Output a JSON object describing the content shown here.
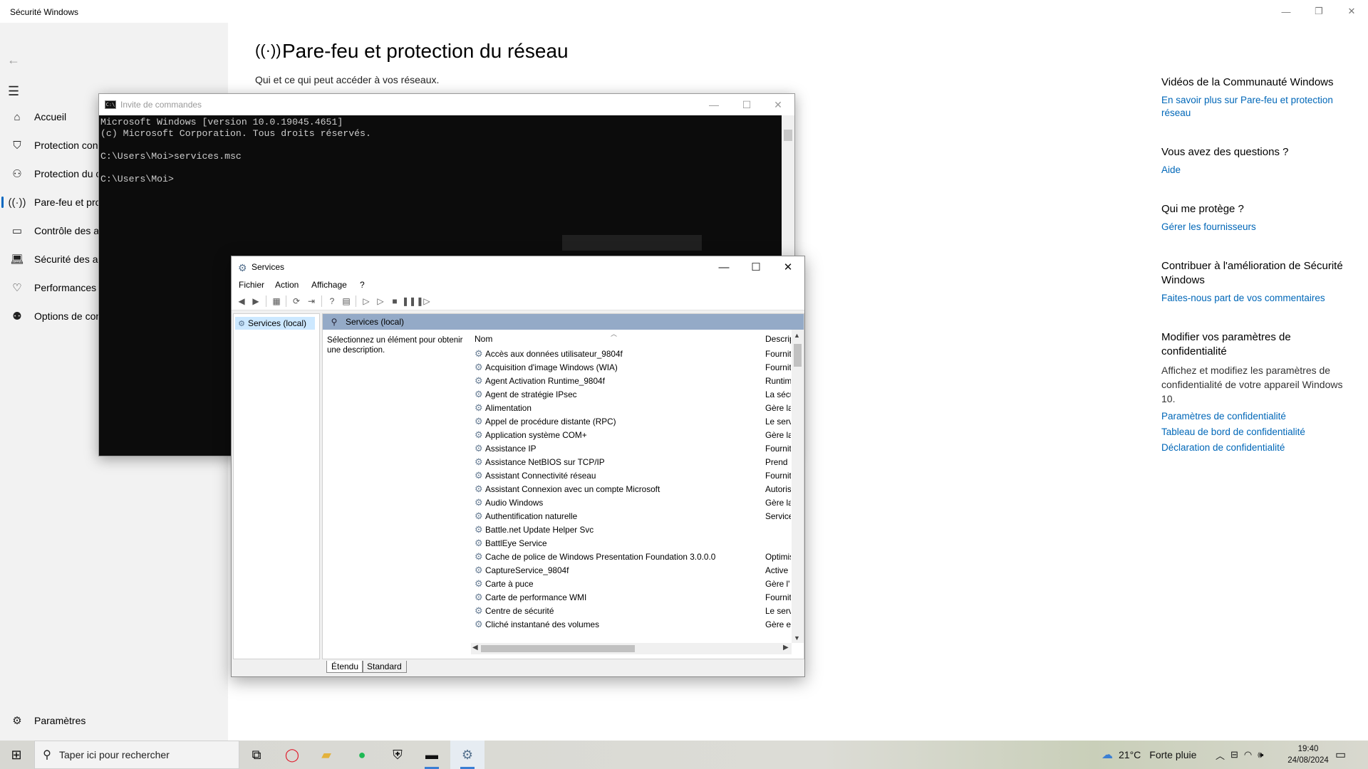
{
  "security": {
    "window_title": "Sécurité Windows",
    "heading": "Pare-feu et protection du réseau",
    "subheading": "Qui et ce qui peut accéder à vos réseaux.",
    "nav": [
      {
        "label": "Accueil"
      },
      {
        "label": "Protection con"
      },
      {
        "label": "Protection du c"
      },
      {
        "label": "Pare-feu et pro"
      },
      {
        "label": "Contrôle des a"
      },
      {
        "label": "Sécurité des ap"
      },
      {
        "label": "Performances e"
      },
      {
        "label": "Options de con"
      }
    ],
    "settings_label": "Paramètres",
    "right_panel": {
      "videos_title": "Vidéos de la Communauté Windows",
      "videos_link": "En savoir plus sur Pare-feu et protection réseau",
      "questions_title": "Vous avez des questions ?",
      "questions_link": "Aide",
      "protect_title": "Qui me protège ?",
      "protect_link": "Gérer les fournisseurs",
      "contribute_title": "Contribuer à l'amélioration de Sécurité Windows",
      "contribute_link": "Faites-nous part de vos commentaires",
      "privacy_title": "Modifier vos paramètres de confidentialité",
      "privacy_text": "Affichez et modifiez les paramètres de confidentialité de votre appareil Windows 10.",
      "privacy_link1": "Paramètres de confidentialité",
      "privacy_link2": "Tableau de bord de confidentialité",
      "privacy_link3": "Déclaration de confidentialité"
    }
  },
  "cmd": {
    "title": "Invite de commandes",
    "lines": "Microsoft Windows [version 10.0.19045.4651]\n(c) Microsoft Corporation. Tous droits réservés.\n\nC:\\Users\\Moi>services.msc\n\nC:\\Users\\Moi>"
  },
  "services": {
    "title": "Services",
    "menu": [
      "Fichier",
      "Action",
      "Affichage",
      "?"
    ],
    "tree_item": "Services (local)",
    "header": "Services (local)",
    "description": "Sélectionnez un élément pour obtenir une description.",
    "col_name": "Nom",
    "col_desc": "Description",
    "rows": [
      {
        "name": "Accès aux données utilisateur_9804f",
        "desc": "Fournit"
      },
      {
        "name": "Acquisition d'image Windows (WIA)",
        "desc": "Fournit"
      },
      {
        "name": "Agent Activation Runtime_9804f",
        "desc": "Runtime"
      },
      {
        "name": "Agent de stratégie IPsec",
        "desc": "La sécurité"
      },
      {
        "name": "Alimentation",
        "desc": "Gère la"
      },
      {
        "name": "Appel de procédure distante (RPC)",
        "desc": "Le service"
      },
      {
        "name": "Application système COM+",
        "desc": "Gère la"
      },
      {
        "name": "Assistance IP",
        "desc": "Fournit"
      },
      {
        "name": "Assistance NetBIOS sur TCP/IP",
        "desc": "Prend"
      },
      {
        "name": "Assistant Connectivité réseau",
        "desc": "Fournit"
      },
      {
        "name": "Assistant Connexion avec un compte Microsoft",
        "desc": "Autorise"
      },
      {
        "name": "Audio Windows",
        "desc": "Gère la"
      },
      {
        "name": "Authentification naturelle",
        "desc": "Service"
      },
      {
        "name": "Battle.net Update Helper Svc",
        "desc": ""
      },
      {
        "name": "BattlEye Service",
        "desc": ""
      },
      {
        "name": "Cache de police de Windows Presentation Foundation 3.0.0.0",
        "desc": "Optimise"
      },
      {
        "name": "CaptureService_9804f",
        "desc": "Active"
      },
      {
        "name": "Carte à puce",
        "desc": "Gère l'"
      },
      {
        "name": "Carte de performance WMI",
        "desc": "Fournit"
      },
      {
        "name": "Centre de sécurité",
        "desc": "Le service"
      },
      {
        "name": "Cliché instantané des volumes",
        "desc": "Gère et"
      }
    ],
    "tabs": [
      "Étendu",
      "Standard"
    ]
  },
  "taskbar": {
    "search_placeholder": "Taper ici pour rechercher",
    "temperature": "21°C",
    "weather": "Forte pluie",
    "time": "19:40",
    "date": "24/08/2024"
  }
}
